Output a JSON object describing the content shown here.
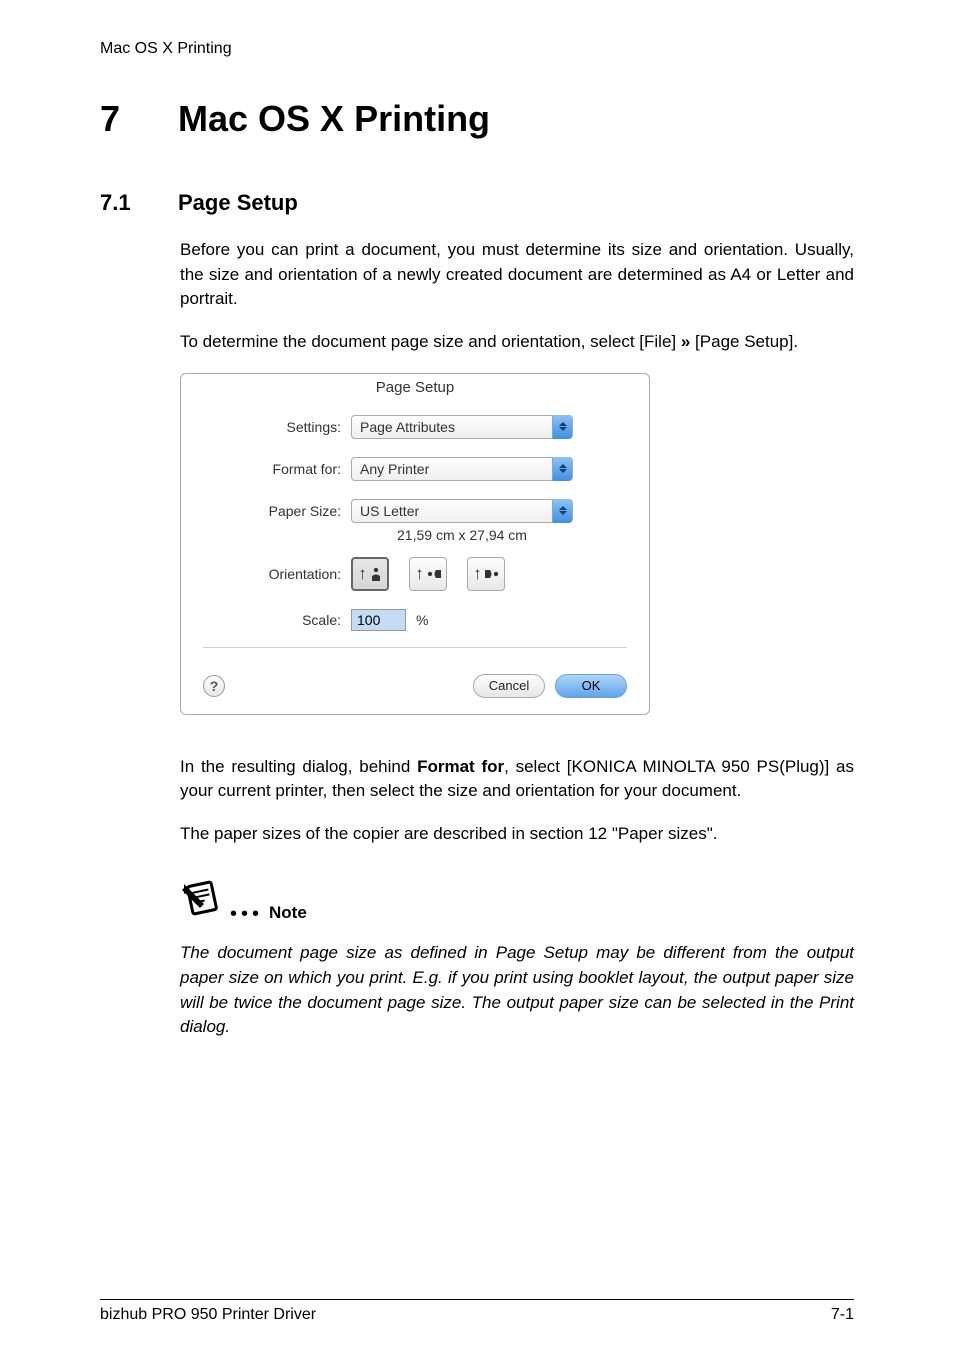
{
  "header": {
    "running": "Mac OS X Printing"
  },
  "chapter": {
    "number": "7",
    "title": "Mac OS X Printing"
  },
  "section": {
    "number": "7.1",
    "title": "Page Setup"
  },
  "para1": "Before you can print a document, you must determine its size and orientation. Usually, the size and orientation of a newly created document are determined as A4 or Letter and portrait.",
  "para2_pre": "To determine the document page size and orientation, select [File] ",
  "para2_sym": "»",
  "para2_post": " [Page Setup].",
  "dialog": {
    "title": "Page Setup",
    "labels": {
      "settings": "Settings:",
      "format_for": "Format for:",
      "paper_size": "Paper Size:",
      "orientation": "Orientation:",
      "scale": "Scale:"
    },
    "values": {
      "settings": "Page Attributes",
      "format_for": "Any Printer",
      "paper_size": "US Letter",
      "paper_dims": "21,59 cm x 27,94 cm",
      "scale": "100",
      "scale_unit": "%"
    },
    "buttons": {
      "help": "?",
      "cancel": "Cancel",
      "ok": "OK"
    }
  },
  "para3_pre": "In the resulting dialog, behind ",
  "para3_bold": "Format for",
  "para3_post": ", select [KONICA MINOLTA 950 PS(Plug)] as your current printer, then select the size and orientation for your document.",
  "para4": "The paper sizes of the copier are described in section 12 \"Paper sizes\".",
  "note": {
    "label": "Note",
    "text": "The document page size as defined in Page Setup may be different from the output paper size on which you print. E.g. if you print using booklet layout, the output paper size will be twice the document page size. The output paper size can be selected in the Print dialog."
  },
  "footer": {
    "left": "bizhub PRO 950 Printer Driver",
    "right": "7-1"
  }
}
